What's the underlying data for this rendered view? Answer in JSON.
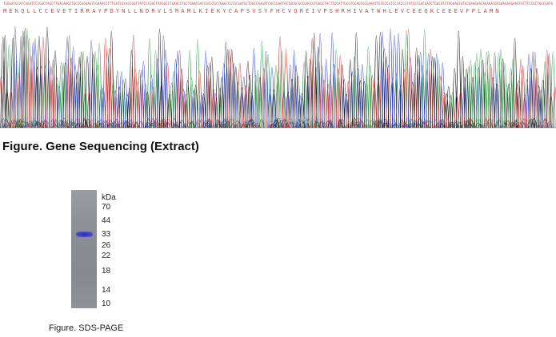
{
  "sequencing": {
    "bases": "TGGGATGCATCGGATTCCGGCTAGCTTGACAAGCTGCCCGGAAGTCGAAACCTTTGATCGCACCGGTTATCCCGACTACGGCCTGAACCTGCTGAACGATCGCGTGCTGAGCCGTGCGATGCTGGCCAAGATCACCGAATACTGCGCGCCGAGCGTGAGCTACTTCCATTGCGTGCAGCGCGAAATTGTGCCGTCCCACCGTATCGTGGCCACCTGGCATCTGGAAGTGTGCGAAGAACAGAAATGCGAAGAAGAAGTGTTTCCGCTGGCGATGAAT",
    "amino_acids": "MEKQLLCCEVETIRRAYPDYNLLNDRVLSRAMLKIEKYCAPSVSYFHCVQREIVPSHRHIVATWHLEVCEEQKCEEEVFPLAMN",
    "caption": "Figure. Gene Sequencing (Extract)",
    "trace_colors": {
      "A": "#2e9b48",
      "C": "#2b3fbd",
      "G": "#111111",
      "T": "#c93030"
    }
  },
  "sds_page": {
    "unit_label": "kDa",
    "markers": [
      70,
      44,
      33,
      26,
      22,
      18,
      14,
      10
    ],
    "band": {
      "kDa": 33
    },
    "caption": "Figure. SDS-PAGE"
  }
}
